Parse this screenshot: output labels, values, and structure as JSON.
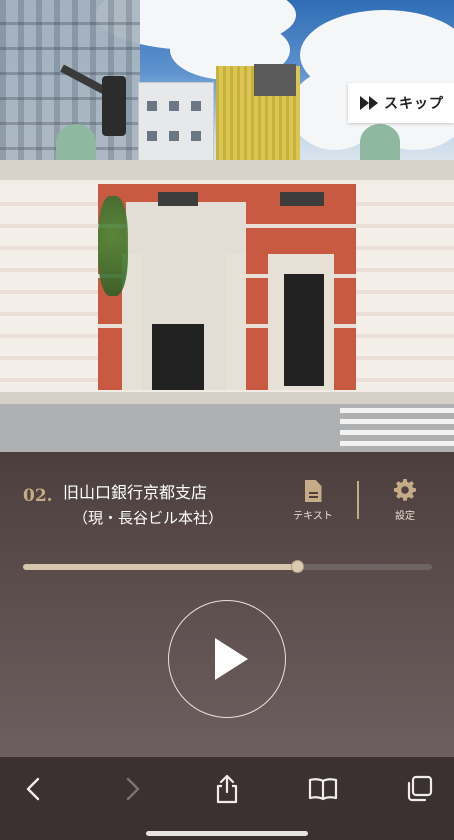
{
  "hero": {
    "skip_label": "スキップ"
  },
  "player": {
    "track_number": "02.",
    "title": "旧山口銀行京都支店",
    "subtitle": "（現・長谷ビル本社）",
    "text_button_label": "テキスト",
    "settings_button_label": "設定",
    "progress": 0.67
  },
  "toolbar": {
    "back": "back-icon",
    "forward": "forward-icon",
    "share": "share-icon",
    "bookmarks": "book-icon",
    "tabs": "tabs-icon"
  },
  "colors": {
    "accent": "#c5ab86",
    "panel": "#4b3f3e",
    "toolbar": "#3b3130"
  }
}
